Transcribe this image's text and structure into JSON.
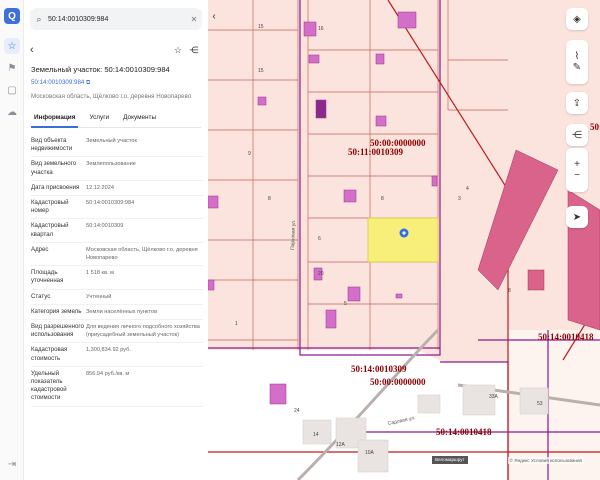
{
  "rail": {
    "logo": "Q",
    "icons": [
      "star-icon",
      "pin-icon",
      "square-icon",
      "cloud-icon"
    ],
    "logout_icon": "logout-icon"
  },
  "search": {
    "value": "50:14:0010309:984",
    "icon": "search-icon",
    "clear_icon": "clear-icon"
  },
  "panel": {
    "title": "Земельный участок: 50:14:0010309:984",
    "cad_link": "50:14:0010309:984 ⧉",
    "address": "Московская область, Щёлково г.о, деревня Новопарево",
    "tabs": [
      {
        "label": "Информация",
        "active": true
      },
      {
        "label": "Услуги",
        "active": false
      },
      {
        "label": "Документы",
        "active": false
      }
    ],
    "rows": [
      {
        "label": "Вид объекта недвижимости",
        "value": "Земельный участок"
      },
      {
        "label": "Вид земельного участка",
        "value": "Землепользование"
      },
      {
        "label": "Дата присвоения",
        "value": "12.12.2024"
      },
      {
        "label": "Кадастровый номер",
        "value": "50:14:0010309:984"
      },
      {
        "label": "Кадастровый квартал",
        "value": "50:14:0010309"
      },
      {
        "label": "Адрес",
        "value": "Московская область, Щёлково г.о, деревня Новопарево"
      },
      {
        "label": "Площадь уточненная",
        "value": "1 518 кв. м"
      },
      {
        "label": "Статус",
        "value": "Учтенный"
      },
      {
        "label": "Категория земель",
        "value": "Земли населённых пунктов"
      },
      {
        "label": "Вид разрешенного использования",
        "value": "Для ведения личного подсобного хозяйства (приусадебный земельный участок)"
      },
      {
        "label": "Кадастровая стоимость",
        "value": "1,300,834.92 руб."
      },
      {
        "label": "Удельный показатель кадастровой стоимости",
        "value": "856.94 руб./кв. м"
      }
    ]
  },
  "map": {
    "labels": {
      "quarter_a": "50:11:0010309",
      "quarter_a_zero": "50:00:0000000",
      "quarter_b": "50:14:0010309",
      "quarter_b_zero": "50:00:0000000",
      "quarter_c": "50:14:0010418",
      "quarter_d": "50:14:0010418",
      "quarter_e": "50:14:0010418",
      "street": "Садовая ул.",
      "lane": "Парковая ул."
    },
    "plot_numbers": [
      "15",
      "16",
      "15",
      "9",
      "8",
      "8",
      "6",
      "20",
      "5",
      "1",
      "24",
      "14",
      "12A",
      "10A",
      "33A",
      "53",
      "4",
      "3",
      "8"
    ],
    "zoom_in": "+",
    "zoom_out": "−",
    "attribution": "© Яндекс  Условия использования",
    "chip": "Веломаршрут",
    "colors": {
      "parcel_fill": "#fbe4de",
      "parcel_line": "#c9605a",
      "boundary": "#8a1a8a",
      "selected": "#f7ef7a",
      "building": "#d46fc9",
      "road": "#c01b1b"
    }
  }
}
